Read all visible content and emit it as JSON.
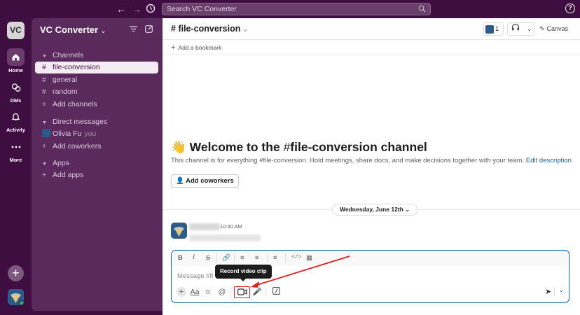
{
  "topbar": {
    "search_placeholder": "Search VC Converter",
    "back_icon": "arrow-left-icon",
    "forward_icon": "arrow-right-icon",
    "history_icon": "clock-icon",
    "help_icon": "help-icon"
  },
  "rail": {
    "workspace_initials": "VC",
    "items": [
      {
        "label": "Home",
        "icon": "home-icon"
      },
      {
        "label": "DMs",
        "icon": "dms-icon"
      },
      {
        "label": "Activity",
        "icon": "bell-icon"
      },
      {
        "label": "More",
        "icon": "more-icon"
      }
    ]
  },
  "sidebar": {
    "workspace_name": "VC Converter",
    "channels_header": "Channels",
    "channels": [
      "file-conversion",
      "general",
      "random"
    ],
    "add_channels": "Add channels",
    "dm_header": "Direct messages",
    "dm_user": "Olivia Fu",
    "dm_you": "you",
    "add_coworkers": "Add coworkers",
    "apps_header": "Apps",
    "add_apps": "Add apps"
  },
  "channel": {
    "name": "file-conversion",
    "hash": "#",
    "member_count": "1",
    "canvas_label": "Canvas",
    "add_bookmark": "Add a bookmark"
  },
  "welcome": {
    "emoji": "👋",
    "title_prefix": "Welcome to the",
    "channel_name": "file-conversion",
    "title_suffix": "channel",
    "description": "This channel is for everything #file-conversion. Hold meetings, share docs, and make decisions together with your team.",
    "edit_link": "Edit description",
    "add_coworkers_button": "Add coworkers"
  },
  "message": {
    "date_divider": "Wednesday, June 12th",
    "time": "10:30 AM"
  },
  "composer": {
    "placeholder": "Message #fi",
    "tooltip": "Record video clip",
    "format_text": "Aa"
  },
  "colors": {
    "sidebar_bg": "#5a2a5c",
    "rail_bg": "#3f0e40",
    "accent_blue": "#1264a3",
    "highlight_red": "#e01e1e"
  }
}
